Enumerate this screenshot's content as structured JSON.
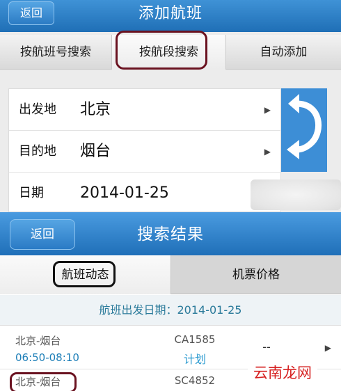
{
  "screen1": {
    "back_label": "返回",
    "title": "添加航班",
    "tabs": [
      "按航班号搜索",
      "按航段搜索",
      "自动添加"
    ],
    "form": {
      "departure_label": "出发地",
      "departure_value": "北京",
      "destination_label": "目的地",
      "destination_value": "烟台",
      "date_label": "日期",
      "date_value": "2014-01-25"
    },
    "swap_icon": "swap-direction-icon"
  },
  "screen2": {
    "back_label": "返回",
    "title": "搜索结果",
    "tabs": [
      "航班动态",
      "机票价格"
    ],
    "date_header": "航班出发日期：2014-01-25",
    "flights": [
      {
        "route": "北京-烟台",
        "time": "06:50-08:10",
        "flight_no": "CA1585",
        "status": "计划",
        "price": "--"
      },
      {
        "route": "北京-烟台",
        "flight_no": "SC4852"
      }
    ]
  },
  "watermark": "云南龙网",
  "colors": {
    "titlebar": "#2a7dc6",
    "highlight_oval": "#6a1220",
    "status_blue": "#2a9ad0",
    "watermark_red": "#d62020"
  }
}
